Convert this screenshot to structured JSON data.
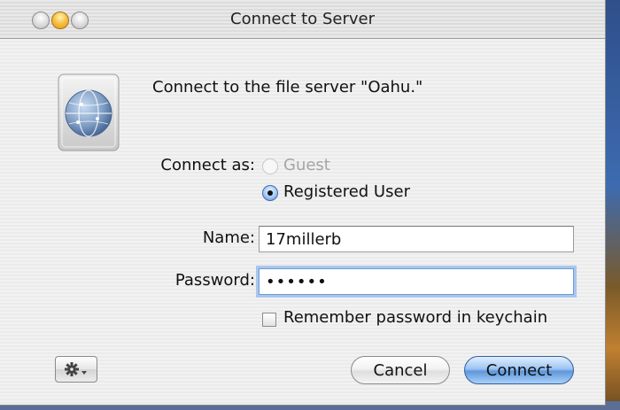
{
  "window": {
    "title": "Connect to Server"
  },
  "dialog": {
    "message": "Connect to the file server \"Oahu.\"",
    "connect_as_label": "Connect as:",
    "options": [
      {
        "label": "Guest",
        "selected": false,
        "enabled": false
      },
      {
        "label": "Registered User",
        "selected": true,
        "enabled": true
      }
    ],
    "name_label": "Name:",
    "name_value": "17millerb",
    "password_label": "Password:",
    "password_value": "••••••",
    "remember_label": "Remember password in keychain",
    "remember_checked": false
  },
  "buttons": {
    "cancel": "Cancel",
    "connect": "Connect"
  },
  "icons": {
    "server": "server-globe-icon",
    "action": "gear-icon",
    "traffic": [
      "close-icon",
      "minimize-icon",
      "zoom-icon"
    ]
  },
  "colors": {
    "default_button": "#5e97dc",
    "focus_ring": "#a9c6ee",
    "minimize": "#e29a10"
  }
}
